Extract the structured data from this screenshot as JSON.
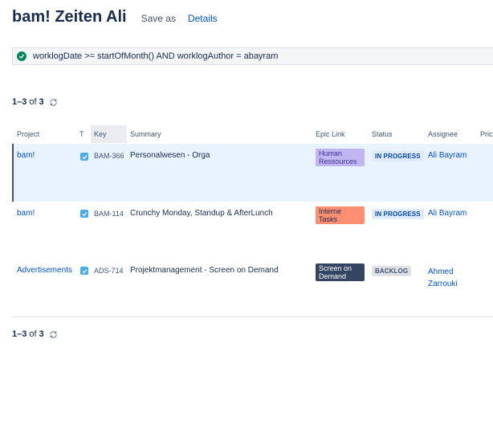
{
  "header": {
    "title": "bam! Zeiten Ali",
    "save_as": "Save as",
    "details": "Details"
  },
  "jql": {
    "query": "worklogDate >= startOfMonth() AND worklogAuthor = abayram"
  },
  "pager": {
    "range": "1–3",
    "of": "of",
    "total": "3"
  },
  "columns": [
    "Project",
    "T",
    "Key",
    "Summary",
    "Epic Link",
    "Status",
    "Assignee",
    "Pric"
  ],
  "rows": [
    {
      "project": "bam!",
      "key": "BAM-366",
      "summary": "Personalwesen - Orga",
      "epic": "Human Ressources",
      "epic_bg": "#c0b6f2",
      "epic_color": "#403294",
      "status": "IN PROGRESS",
      "status_bg": "#deebff",
      "status_color": "#0747a6",
      "assignee": "Ali Bayram"
    },
    {
      "project": "bam!",
      "key": "BAM-114",
      "summary": "Crunchy Monday, Standup & AfterLunch",
      "epic": "Interne Tasks",
      "epic_bg": "#ff8f73",
      "epic_color": "#172b4d",
      "status": "IN PROGRESS",
      "status_bg": "#deebff",
      "status_color": "#0747a6",
      "assignee": "Ali Bayram"
    },
    {
      "project": "Advertisements",
      "key": "ADS-714",
      "summary": "Projektmanagement - Screen on Demand",
      "epic": "Screen on Demand",
      "epic_bg": "#344563",
      "epic_color": "#ffffff",
      "status": "BACKLOG",
      "status_bg": "#dfe1e6",
      "status_color": "#42526e",
      "assignee": "Ahmed Zarrouki"
    }
  ]
}
